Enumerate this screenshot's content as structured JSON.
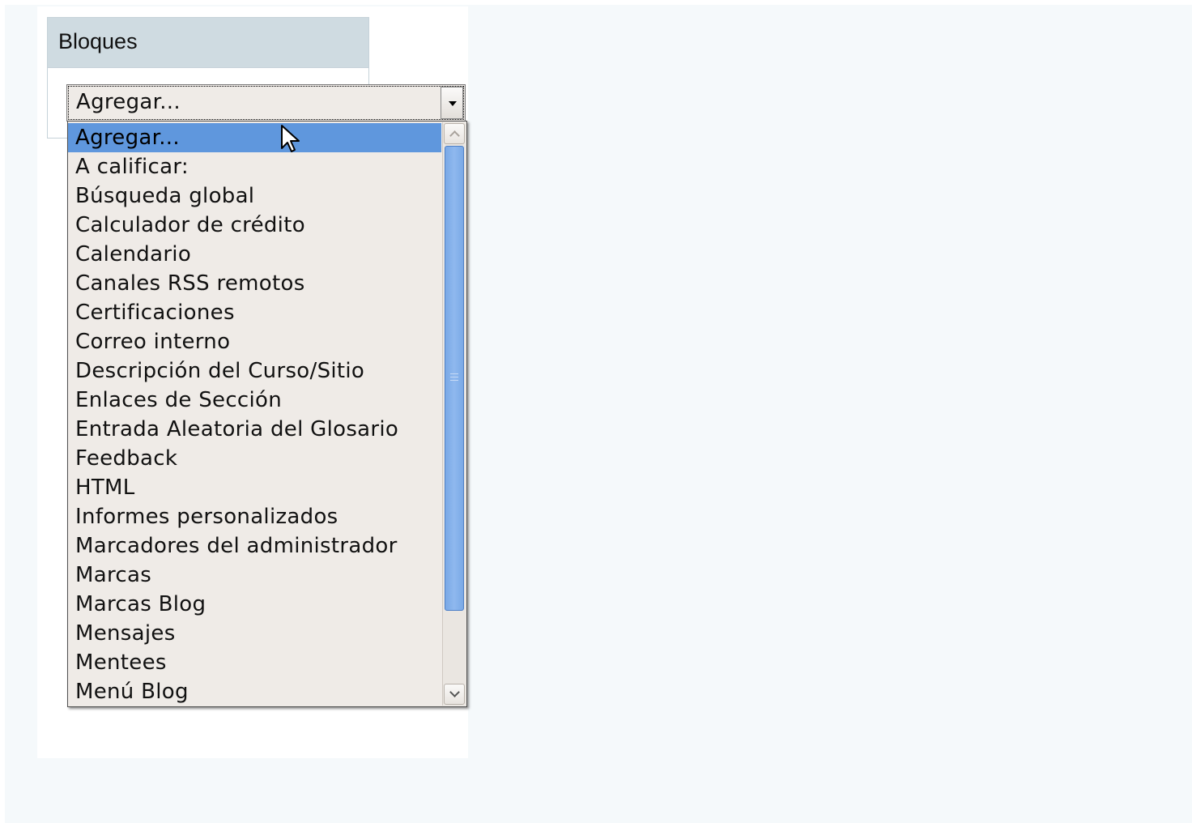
{
  "block": {
    "title": "Bloques"
  },
  "select": {
    "value": "Agregar...",
    "options": [
      "Agregar...",
      "A calificar:",
      "Búsqueda global",
      "Calculador de crédito",
      "Calendario",
      "Canales RSS remotos",
      "Certificaciones",
      "Correo interno",
      "Descripción del Curso/Sitio",
      "Enlaces de Sección",
      "Entrada Aleatoria del Glosario",
      "Feedback",
      "HTML",
      "Informes personalizados",
      "Marcadores del administrador",
      "Marcas",
      "Marcas Blog",
      "Mensajes",
      "Mentees",
      "Menú Blog"
    ],
    "highlighted_index": 0
  },
  "colors": {
    "highlight": "#5f97dd",
    "block_header": "#cfdbe1",
    "page_background": "#f5f9fb"
  },
  "icons": {
    "cursor": "arrow-cursor-icon",
    "dropdown_arrow": "chevron-down-icon"
  }
}
